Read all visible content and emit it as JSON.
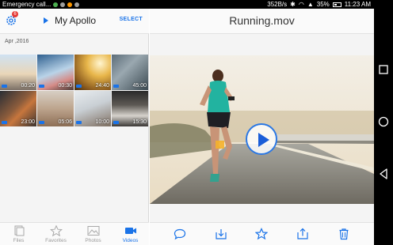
{
  "status_bar": {
    "left_text": "Emergency call...",
    "network_speed": "352B/s",
    "battery": "35%",
    "time": "11:23 AM"
  },
  "left_pane": {
    "settings_badge": "6",
    "album_title": "My Apollo",
    "select_label": "SELECT",
    "date_header": "Apr ,2016",
    "thumbnails": [
      {
        "duration": "00:20"
      },
      {
        "duration": "00:30"
      },
      {
        "duration": "24:40"
      },
      {
        "duration": "45:00"
      },
      {
        "duration": "23:00"
      },
      {
        "duration": "05:06"
      },
      {
        "duration": "10:00"
      },
      {
        "duration": "15:30"
      }
    ],
    "tabs": [
      {
        "label": "Files",
        "icon": "files-icon",
        "active": false
      },
      {
        "label": "Favorites",
        "icon": "star-icon",
        "active": false
      },
      {
        "label": "Photos",
        "icon": "photos-icon",
        "active": false
      },
      {
        "label": "Videos",
        "icon": "video-camera-icon",
        "active": true
      }
    ]
  },
  "right_pane": {
    "video_title": "Running.mov",
    "actions": [
      "comment-icon",
      "download-icon",
      "star-icon",
      "share-icon",
      "trash-icon"
    ]
  },
  "colors": {
    "accent": "#1a73e8",
    "badge": "#e53935"
  }
}
